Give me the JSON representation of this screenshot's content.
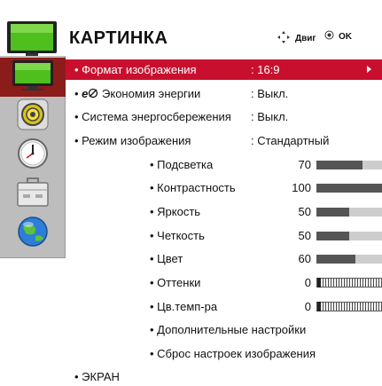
{
  "header": {
    "title": "КАРТИНКА",
    "hint_move": "Двиг",
    "hint_ok": "OK"
  },
  "sidebar": {
    "items": [
      {
        "icon": "tv-screen-icon",
        "active": true
      },
      {
        "icon": "speaker-icon",
        "active": false
      },
      {
        "icon": "clock-icon",
        "active": false
      },
      {
        "icon": "toolbox-icon",
        "active": false
      },
      {
        "icon": "globe-icon",
        "active": false
      }
    ]
  },
  "menu": {
    "format": {
      "label": "• Формат изображения",
      "value": ": 16:9"
    },
    "eco": {
      "label_prefix": "• ",
      "eco_logo": "e",
      "label": " Экономия энергии",
      "value": ": Выкл."
    },
    "saving": {
      "label": "• Система энергосбережения",
      "value": ": Выкл."
    },
    "mode": {
      "label": "• Режим изображения",
      "value": ": Стандартный"
    },
    "backlight": {
      "label": "• Подсветка",
      "value": "70",
      "level": 70,
      "max": 100
    },
    "contrast": {
      "label": "• Контрастность",
      "value": "100",
      "level": 100,
      "max": 100
    },
    "brightness": {
      "label": "• Яркость",
      "value": "50",
      "level": 50,
      "max": 100
    },
    "sharpness": {
      "label": "• Четкость",
      "value": "50",
      "level": 50,
      "max": 100
    },
    "color": {
      "label": "• Цвет",
      "value": "60",
      "level": 60,
      "max": 100
    },
    "tint": {
      "label": "• Оттенки",
      "value": "0"
    },
    "colortemp": {
      "label": "• Цв.темп-ра",
      "value": "0"
    },
    "advanced": {
      "label": "• Дополнительные настройки"
    },
    "reset": {
      "label": "• Сброс настроек изображения"
    },
    "screen": {
      "label": "• ЭКРАН"
    }
  },
  "colors": {
    "selected_row": "#c8102e",
    "active_sidebar": "#8c1c19",
    "sidebar_bg": "#bdbdbd",
    "bar_fill": "#555555",
    "bar_track": "#cdcdcd"
  }
}
